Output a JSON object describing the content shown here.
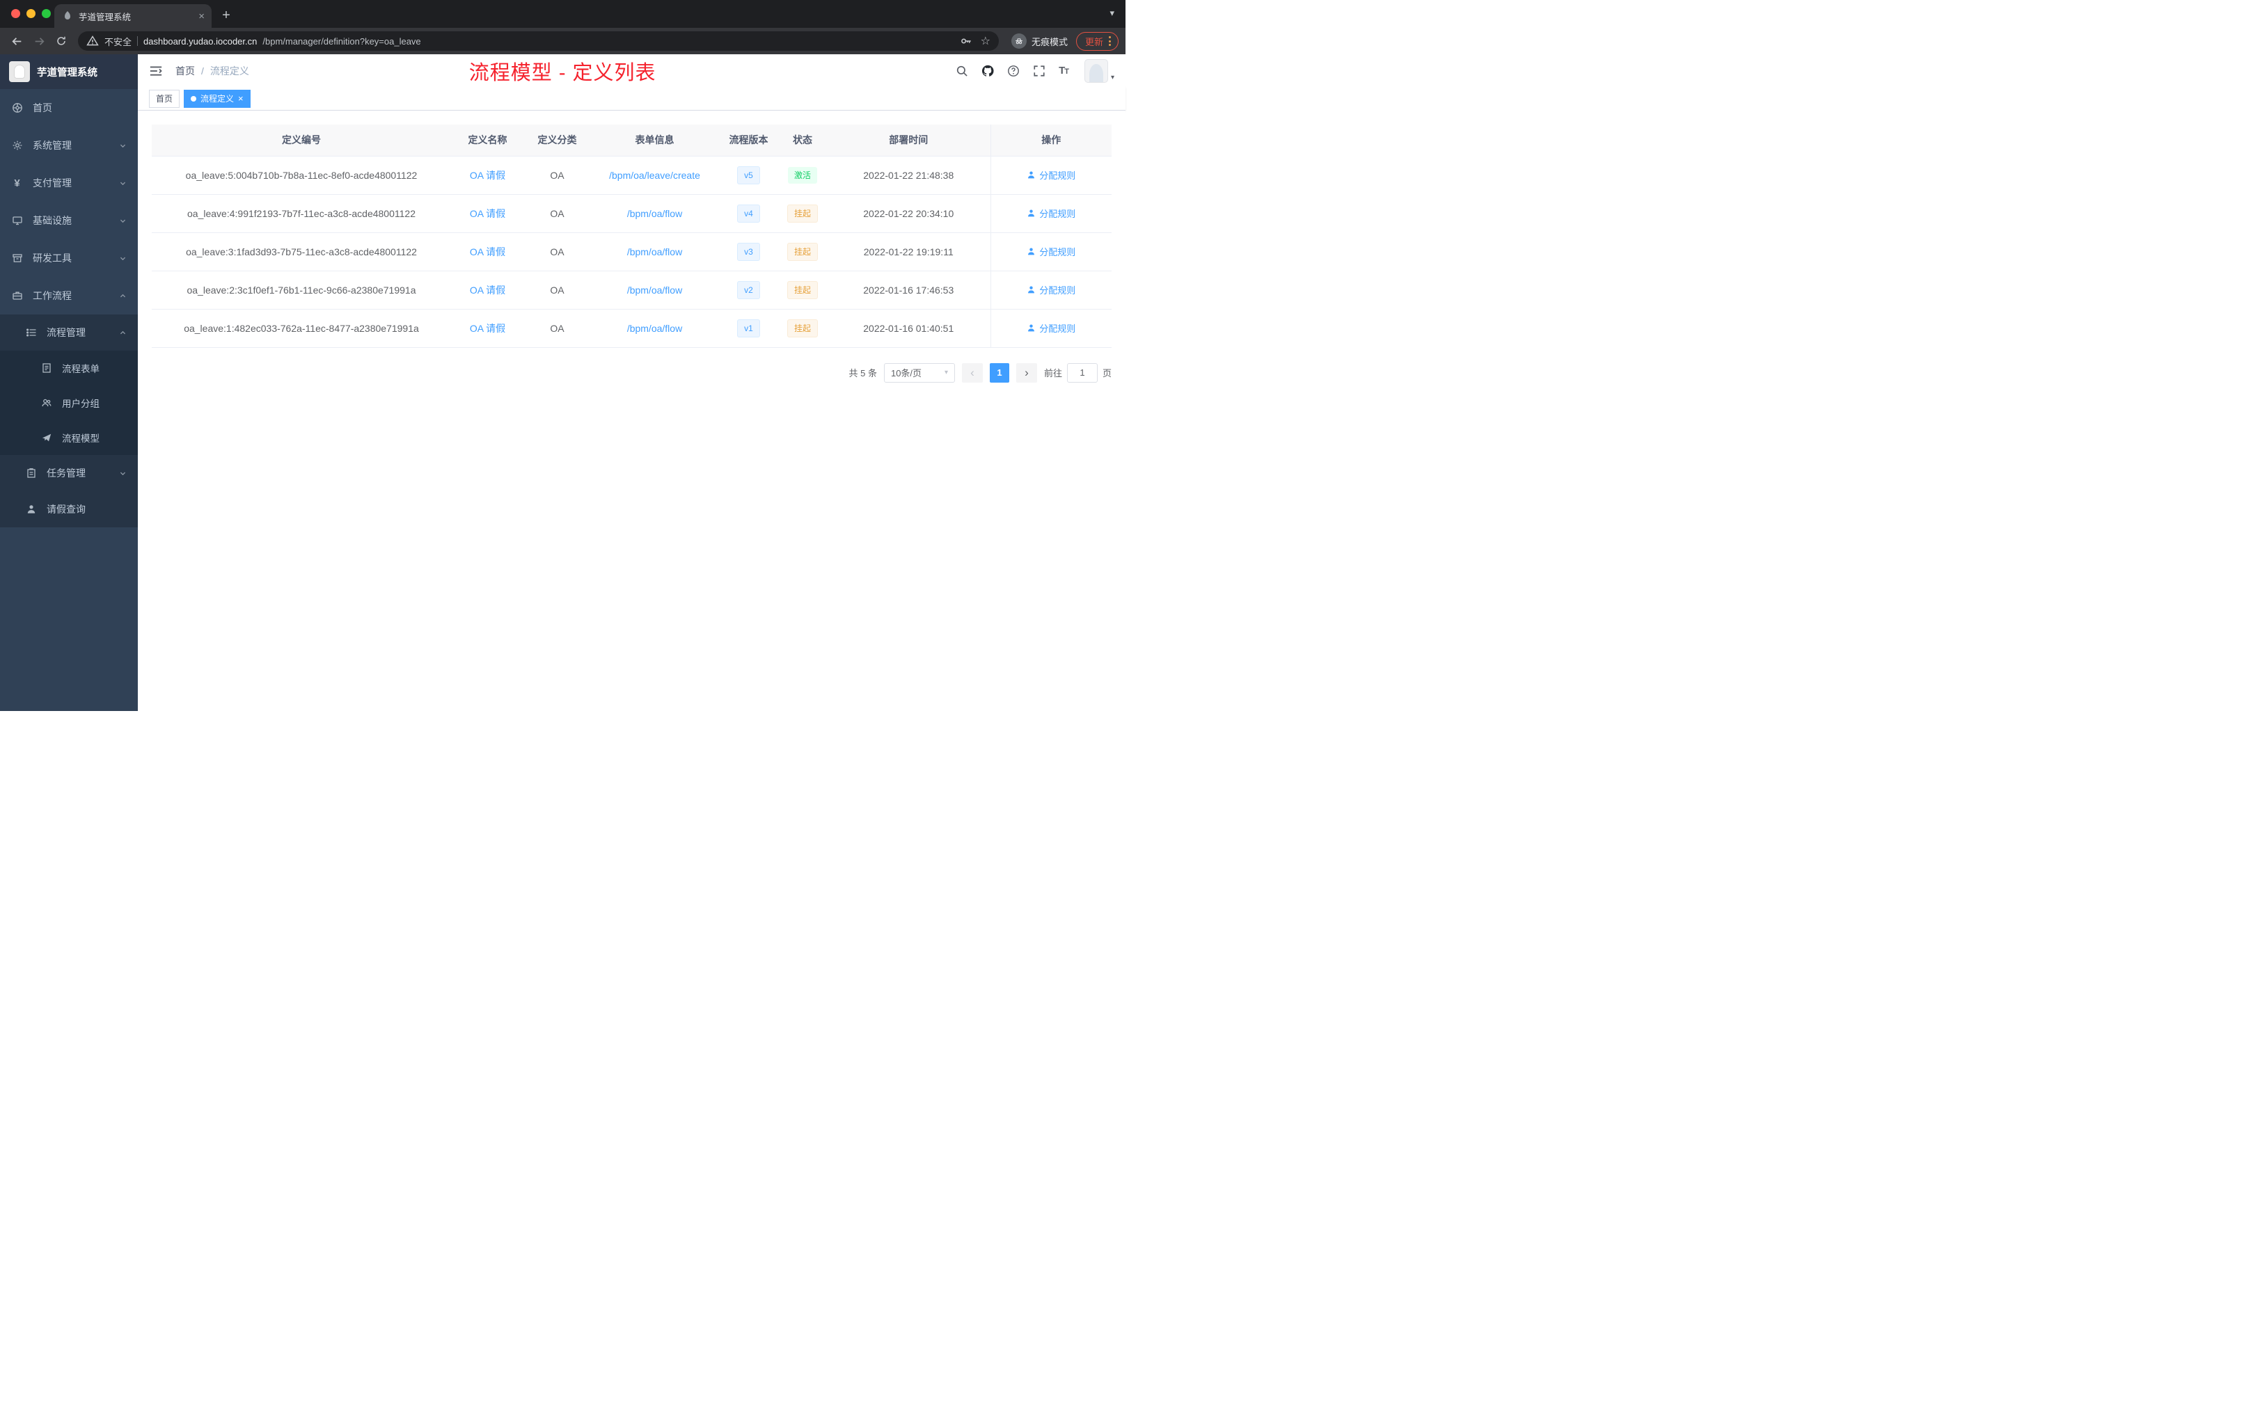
{
  "browser": {
    "tab_title": "芋道管理系统",
    "security_label": "不安全",
    "url_host": "dashboard.yudao.iocoder.cn",
    "url_path": "/bpm/manager/definition?key=oa_leave",
    "incognito_label": "无痕模式",
    "update_label": "更新"
  },
  "icons": {
    "close": "×",
    "plus": "+",
    "caret_down": "▾",
    "star": "☆",
    "prev": "‹",
    "next": "›",
    "slash": "/"
  },
  "sidebar": {
    "logo_title": "芋道管理系统",
    "menu": {
      "home": "首页",
      "system": "系统管理",
      "payment": "支付管理",
      "infrastructure": "基础设施",
      "devtools": "研发工具",
      "workflow": "工作流程",
      "process_management": "流程管理",
      "process_form": "流程表单",
      "user_group": "用户分组",
      "process_model": "流程模型",
      "task_management": "任务管理",
      "leave_query": "请假查询"
    }
  },
  "header": {
    "breadcrumb": {
      "home": "首页",
      "separator": "/",
      "current": "流程定义"
    },
    "annotation": "流程模型 - 定义列表",
    "fontsize_big": "T",
    "fontsize_small": "T"
  },
  "tags": {
    "home": "首页",
    "active": "流程定义"
  },
  "table": {
    "columns": [
      "定义编号",
      "定义名称",
      "定义分类",
      "表单信息",
      "流程版本",
      "状态",
      "部署时间",
      "操作"
    ],
    "rows": [
      {
        "id": "oa_leave:5:004b710b-7b8a-11ec-8ef0-acde48001122",
        "name": "OA 请假",
        "category": "OA",
        "form": "/bpm/oa/leave/create",
        "version": "v5",
        "status": "激活",
        "deploy_time": "2022-01-22 21:48:38",
        "action": "分配规则"
      },
      {
        "id": "oa_leave:4:991f2193-7b7f-11ec-a3c8-acde48001122",
        "name": "OA 请假",
        "category": "OA",
        "form": "/bpm/oa/flow",
        "version": "v4",
        "status": "挂起",
        "deploy_time": "2022-01-22 20:34:10",
        "action": "分配规则"
      },
      {
        "id": "oa_leave:3:1fad3d93-7b75-11ec-a3c8-acde48001122",
        "name": "OA 请假",
        "category": "OA",
        "form": "/bpm/oa/flow",
        "version": "v3",
        "status": "挂起",
        "deploy_time": "2022-01-22 19:19:11",
        "action": "分配规则"
      },
      {
        "id": "oa_leave:2:3c1f0ef1-76b1-11ec-9c66-a2380e71991a",
        "name": "OA 请假",
        "category": "OA",
        "form": "/bpm/oa/flow",
        "version": "v2",
        "status": "挂起",
        "deploy_time": "2022-01-16 17:46:53",
        "action": "分配规则"
      },
      {
        "id": "oa_leave:1:482ec033-762a-11ec-8477-a2380e71991a",
        "name": "OA 请假",
        "category": "OA",
        "form": "/bpm/oa/flow",
        "version": "v1",
        "status": "挂起",
        "deploy_time": "2022-01-16 01:40:51",
        "action": "分配规则"
      }
    ]
  },
  "pagination": {
    "total": "共 5 条",
    "page_size": "10条/页",
    "page": "1",
    "goto_label": "前往",
    "goto_value": "1",
    "unit": "页"
  },
  "colors": {
    "accent": "#409eff",
    "annotation_red": "#f5222d",
    "active_text": "#13ce66",
    "active_bg": "#e8fff3",
    "suspend_text": "#e6a23c",
    "suspend_bg": "#fdf6ec",
    "version_text": "#409eff",
    "version_bg": "#ecf5ff",
    "sidebar_bg": "#304156",
    "sidebar_sub_bg": "#263445",
    "sidebar_subsub_bg": "#1f2d3d"
  }
}
